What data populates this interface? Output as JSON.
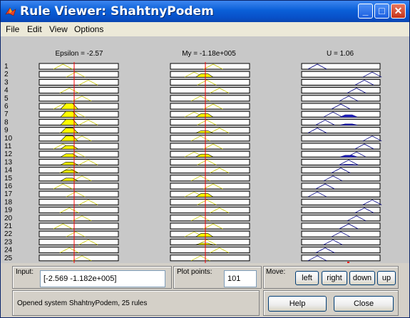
{
  "window": {
    "title": "Rule Viewer: ShahtnyPodem",
    "controls": {
      "minimize": "_",
      "maximize": "□",
      "close": "✕"
    }
  },
  "menu": [
    "File",
    "Edit",
    "View",
    "Options"
  ],
  "plots": {
    "headers": {
      "epsilon": "Epsilon = -2.57",
      "my": "My = -1.18e+005",
      "u": "U = 1.06"
    },
    "rule_numbers": [
      "1",
      "2",
      "3",
      "4",
      "5",
      "6",
      "7",
      "8",
      "9",
      "10",
      "11",
      "12",
      "13",
      "14",
      "15",
      "16",
      "17",
      "18",
      "19",
      "20",
      "21",
      "22",
      "23",
      "24",
      "25"
    ],
    "rule_count": 25,
    "epsilon_activation": [
      0,
      0,
      0,
      0,
      0,
      1,
      1,
      1,
      0.9,
      0.9,
      0.6,
      0.55,
      0.5,
      0.5,
      0.5,
      0,
      0,
      0,
      0,
      0,
      0,
      0,
      0,
      0,
      0
    ],
    "my_activation": [
      0,
      0.6,
      0,
      0,
      0,
      0,
      0.6,
      0,
      0.4,
      0,
      0,
      0.5,
      0,
      0,
      0,
      0,
      0.6,
      0,
      0,
      0,
      0,
      0.6,
      0.3,
      0,
      0
    ],
    "u_activation": [
      0,
      0,
      0,
      0,
      0,
      0,
      0.4,
      0.2,
      0,
      0,
      0,
      0.3,
      0.1,
      0,
      0,
      0,
      0,
      0,
      0,
      0,
      0,
      0,
      0,
      0,
      0
    ],
    "colors": {
      "input_fill": "#ffff00",
      "input_outline": "#c8c800",
      "output_outline": "#000080",
      "output_fill": "#2020c0",
      "index_line": "#ff0000",
      "background": "#c8c8c8"
    }
  },
  "controls": {
    "input_label": "Input:",
    "input_value": "[-2.569 -1.182e+005]",
    "plot_points_label": "Plot points:",
    "plot_points_value": "101",
    "move_label": "Move:",
    "move_buttons": {
      "left": "left",
      "right": "right",
      "down": "down",
      "up": "up"
    },
    "help_button": "Help",
    "close_button": "Close"
  },
  "status": "Opened system ShahtnyPodem, 25 rules"
}
